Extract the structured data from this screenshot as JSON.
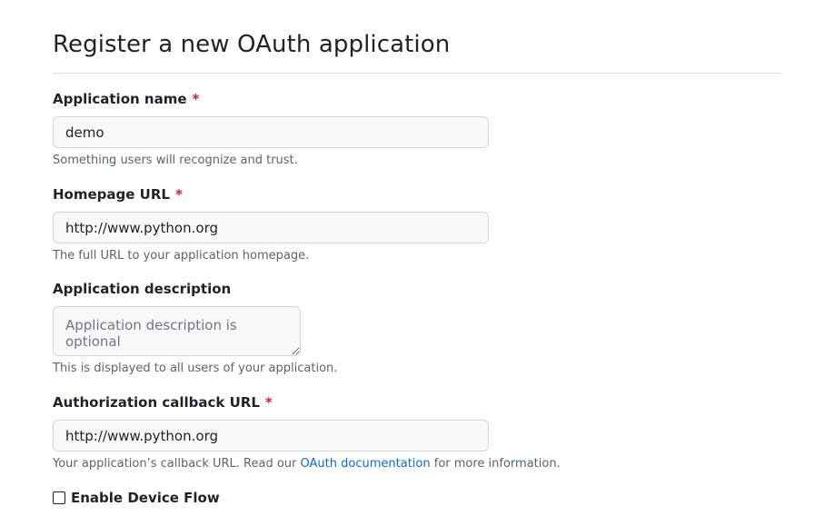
{
  "page": {
    "title": "Register a new OAuth application"
  },
  "fields": {
    "app_name": {
      "label": "Application name",
      "required_mark": "*",
      "value": "demo",
      "note": "Something users will recognize and trust."
    },
    "homepage_url": {
      "label": "Homepage URL",
      "required_mark": "*",
      "value": "http://www.python.org",
      "note": "The full URL to your application homepage."
    },
    "description": {
      "label": "Application description",
      "placeholder": "Application description is optional",
      "note": "This is displayed to all users of your application."
    },
    "callback_url": {
      "label": "Authorization callback URL",
      "required_mark": "*",
      "value": "http://www.python.org",
      "note_before": "Your application’s callback URL. Read our ",
      "note_link": "OAuth documentation",
      "note_after": " for more information."
    }
  },
  "device_flow": {
    "label": "Enable Device Flow",
    "checked": false
  },
  "colors": {
    "required": "#cf222e",
    "link": "#0969da"
  }
}
